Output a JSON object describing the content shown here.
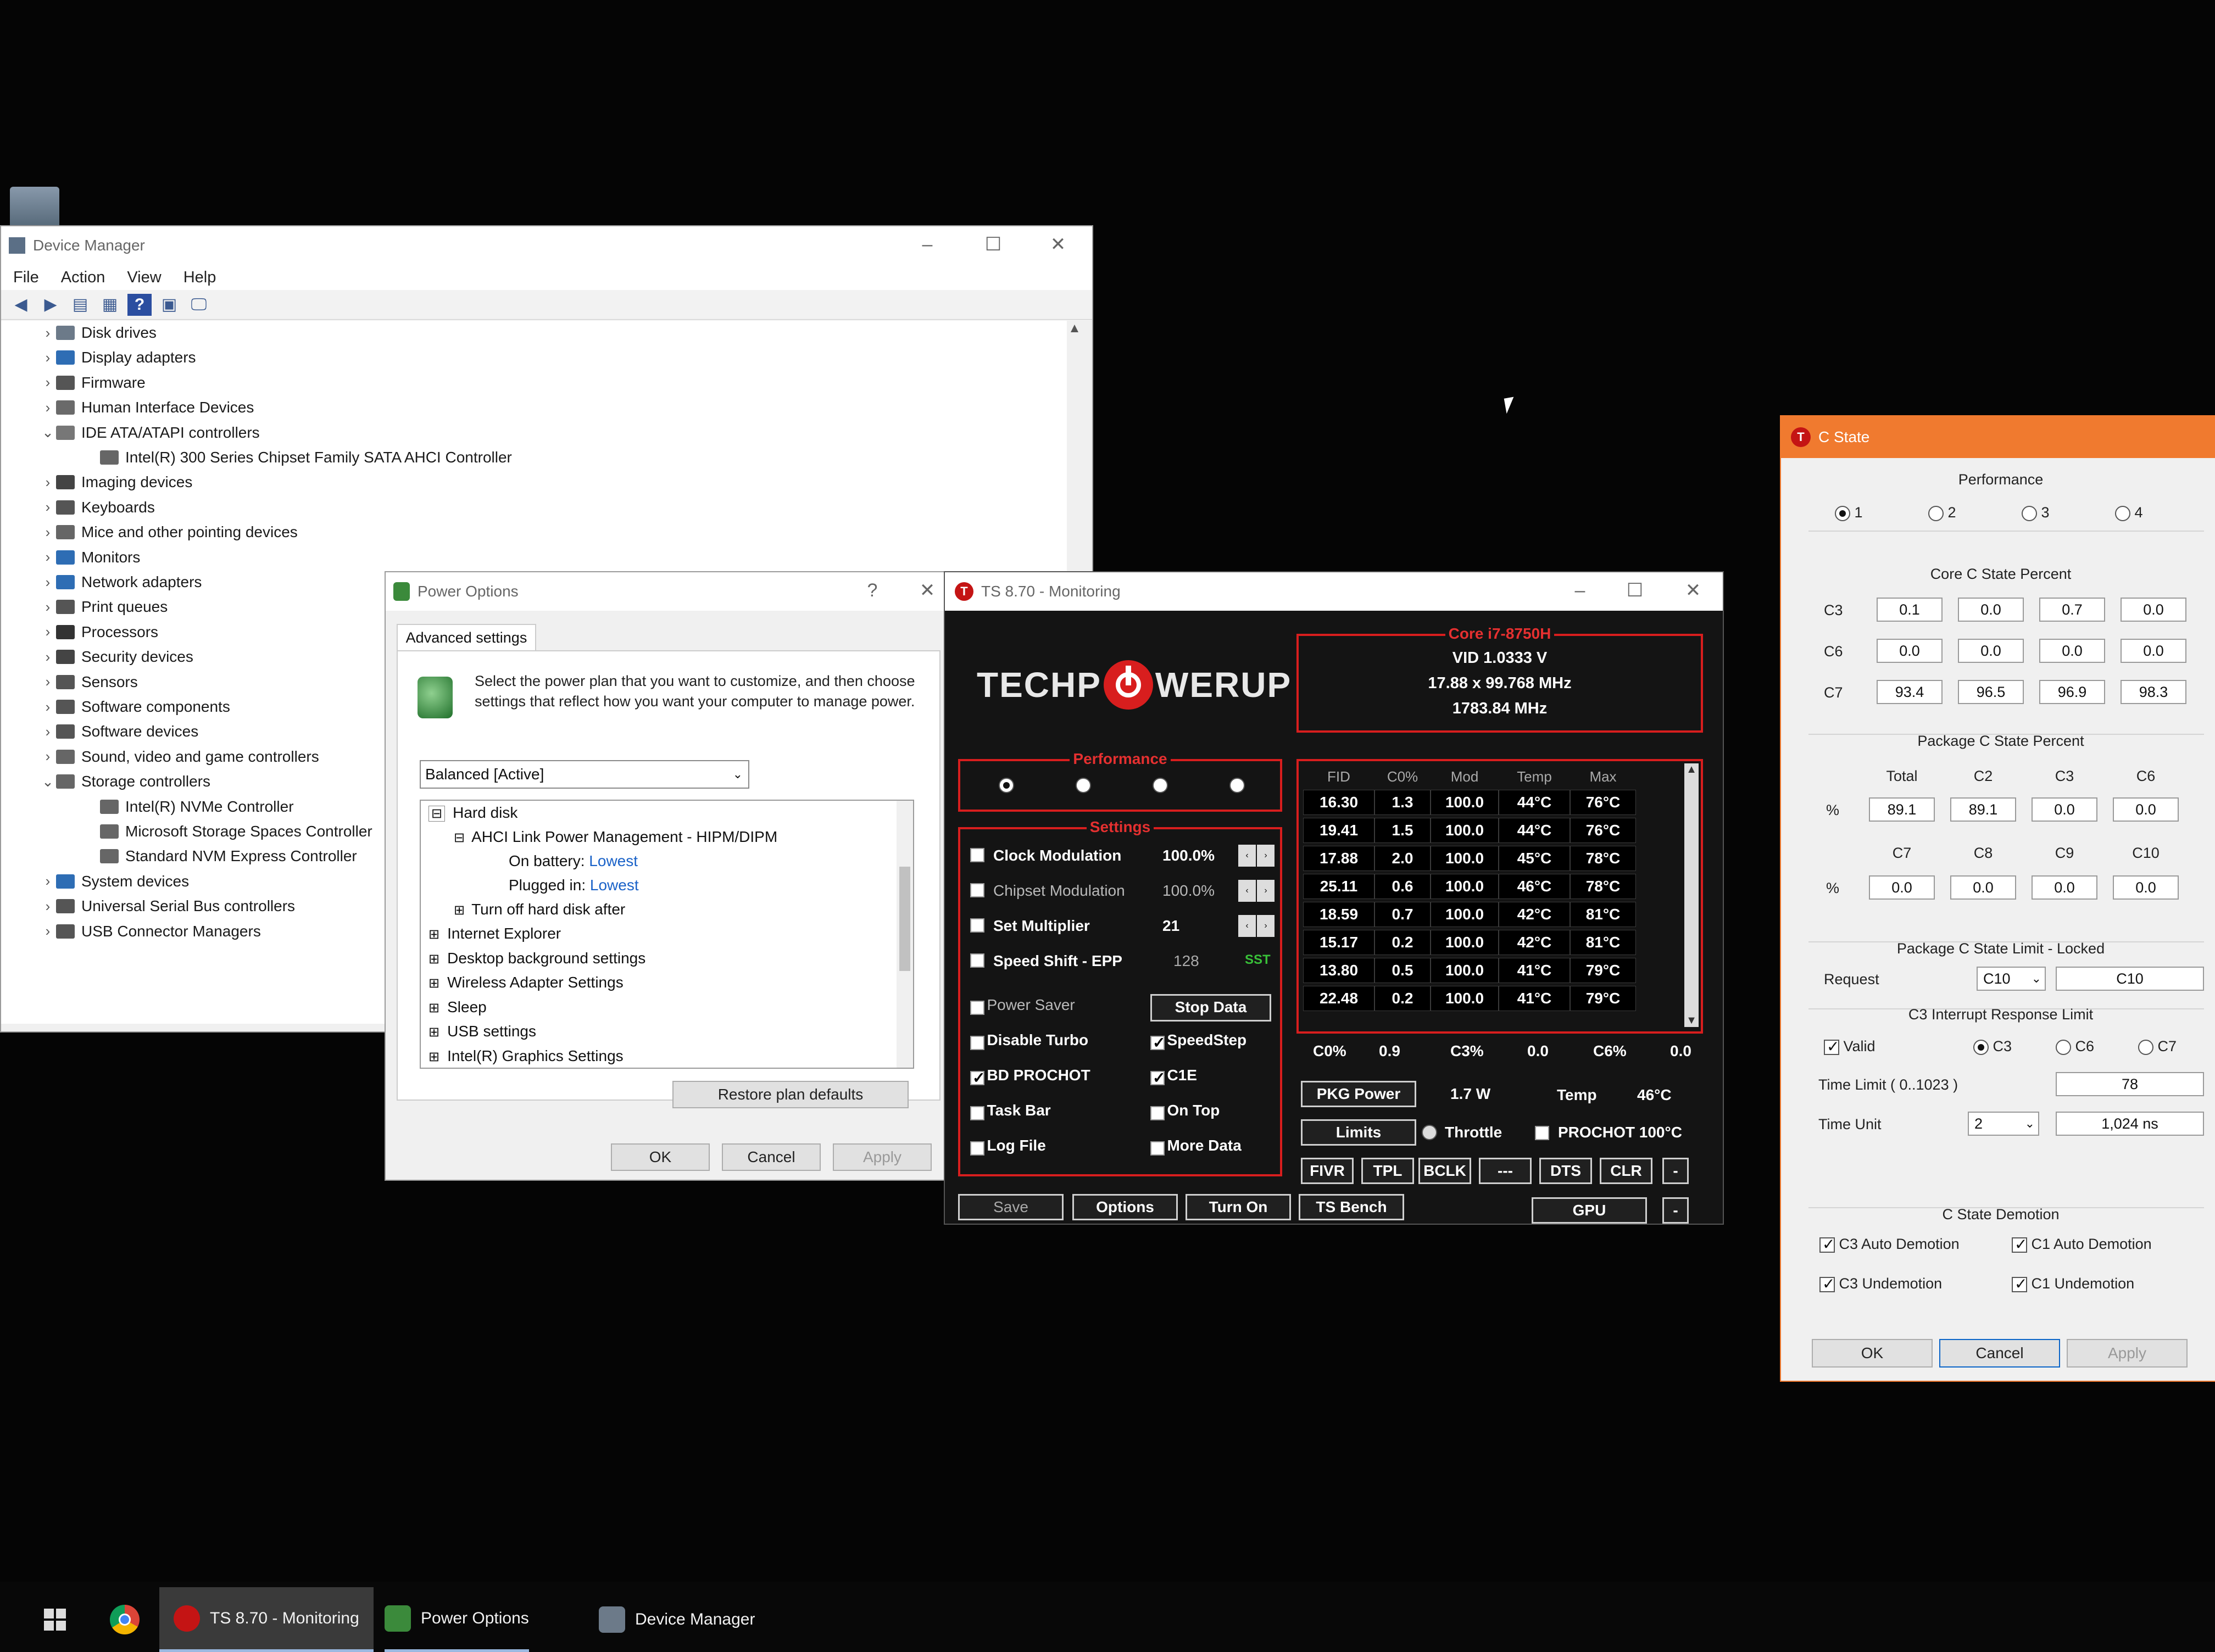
{
  "colors": {
    "accent_red": "#d81e1e",
    "cstate_title": "#f07a2f",
    "link_blue": "#1a62c8",
    "sst_green": "#39c039"
  },
  "device_manager": {
    "title": "Device Manager",
    "menu": [
      "File",
      "Action",
      "View",
      "Help"
    ],
    "tree": [
      {
        "label": "Disk drives",
        "expanded": false,
        "icon": "disk-icon"
      },
      {
        "label": "Display adapters",
        "expanded": false,
        "icon": "display-icon"
      },
      {
        "label": "Firmware",
        "expanded": false,
        "icon": "chip-icon"
      },
      {
        "label": "Human Interface Devices",
        "expanded": false,
        "icon": "hid-icon"
      },
      {
        "label": "IDE ATA/ATAPI controllers",
        "expanded": true,
        "icon": "ide-icon"
      },
      {
        "label": "Intel(R) 300 Series Chipset Family SATA AHCI Controller",
        "child": true,
        "icon": "controller-icon"
      },
      {
        "label": "Imaging devices",
        "expanded": false,
        "icon": "camera-icon"
      },
      {
        "label": "Keyboards",
        "expanded": false,
        "icon": "keyboard-icon"
      },
      {
        "label": "Mice and other pointing devices",
        "expanded": false,
        "icon": "mouse-icon"
      },
      {
        "label": "Monitors",
        "expanded": false,
        "icon": "monitor-icon"
      },
      {
        "label": "Network adapters",
        "expanded": false,
        "icon": "network-icon"
      },
      {
        "label": "Print queues",
        "expanded": false,
        "icon": "printer-icon"
      },
      {
        "label": "Processors",
        "expanded": false,
        "icon": "cpu-icon"
      },
      {
        "label": "Security devices",
        "expanded": false,
        "icon": "security-icon"
      },
      {
        "label": "Sensors",
        "expanded": false,
        "icon": "sensor-icon"
      },
      {
        "label": "Software components",
        "expanded": false,
        "icon": "component-icon"
      },
      {
        "label": "Software devices",
        "expanded": false,
        "icon": "software-icon"
      },
      {
        "label": "Sound, video and game controllers",
        "expanded": false,
        "icon": "sound-icon"
      },
      {
        "label": "Storage controllers",
        "expanded": true,
        "icon": "storage-icon"
      },
      {
        "label": "Intel(R) NVMe Controller",
        "child": true,
        "icon": "controller-icon"
      },
      {
        "label": "Microsoft Storage Spaces Controller",
        "child": true,
        "icon": "controller-icon"
      },
      {
        "label": "Standard NVM Express Controller",
        "child": true,
        "icon": "controller-icon"
      },
      {
        "label": "System devices",
        "expanded": false,
        "icon": "system-icon"
      },
      {
        "label": "Universal Serial Bus controllers",
        "expanded": false,
        "icon": "usb-icon"
      },
      {
        "label": "USB Connector Managers",
        "expanded": false,
        "icon": "usb-icon"
      }
    ]
  },
  "power_options": {
    "title": "Power Options",
    "help": "?",
    "tab": "Advanced settings",
    "description": "Select the power plan that you want to customize, and then choose settings that reflect how you want your computer to manage power.",
    "plan": "Balanced [Active]",
    "settings": {
      "hard_disk": "Hard disk",
      "ahci": "AHCI Link Power Management - HIPM/DIPM",
      "on_battery_label": "On battery:",
      "on_battery_value": "Lowest",
      "plugged_label": "Plugged in:",
      "plugged_value": "Lowest",
      "turn_off": "Turn off hard disk after",
      "others": [
        "Internet Explorer",
        "Desktop background settings",
        "Wireless Adapter Settings",
        "Sleep",
        "USB settings",
        "Intel(R) Graphics Settings"
      ]
    },
    "restore": "Restore plan defaults",
    "ok": "OK",
    "cancel": "Cancel",
    "apply": "Apply"
  },
  "throttlestop": {
    "title": "TS 8.70 - Monitoring",
    "logo_left": "TECHP",
    "logo_right": "WERUP",
    "cpu": {
      "title": "Core i7-8750H",
      "vid": "VID  1.0333 V",
      "multi": "17.88 x 99.768 MHz",
      "freq": "1783.84 MHz"
    },
    "performance_title": "Performance",
    "settings_title": "Settings",
    "options": [
      {
        "label": "Clock Modulation",
        "value": "100.0%",
        "checked": false,
        "dim": false
      },
      {
        "label": "Chipset Modulation",
        "value": "100.0%",
        "checked": false,
        "dim": true
      },
      {
        "label": "Set Multiplier",
        "value": "21",
        "checked": false,
        "dim": false
      },
      {
        "label": "Speed Shift - EPP",
        "value": "128",
        "extra": "SST",
        "checked": false,
        "dim": false
      }
    ],
    "left_checks": [
      {
        "label": "Power Saver",
        "checked": false,
        "dim": true
      },
      {
        "label": "Disable Turbo",
        "checked": false
      },
      {
        "label": "BD PROCHOT",
        "checked": true
      },
      {
        "label": "Task Bar",
        "checked": false
      },
      {
        "label": "Log File",
        "checked": false
      }
    ],
    "right_checks": [
      {
        "label": "SpeedStep",
        "checked": true
      },
      {
        "label": "C1E",
        "checked": true
      },
      {
        "label": "On Top",
        "checked": false
      },
      {
        "label": "More Data",
        "checked": false
      }
    ],
    "stop_data": "Stop Data",
    "grid": {
      "headers": [
        "FID",
        "C0%",
        "Mod",
        "Temp",
        "Max"
      ],
      "rows": [
        [
          "16.30",
          "1.3",
          "100.0",
          "44°C",
          "76°C"
        ],
        [
          "19.41",
          "1.5",
          "100.0",
          "44°C",
          "76°C"
        ],
        [
          "17.88",
          "2.0",
          "100.0",
          "45°C",
          "78°C"
        ],
        [
          "25.11",
          "0.6",
          "100.0",
          "46°C",
          "78°C"
        ],
        [
          "18.59",
          "0.7",
          "100.0",
          "42°C",
          "81°C"
        ],
        [
          "15.17",
          "0.2",
          "100.0",
          "42°C",
          "81°C"
        ],
        [
          "13.80",
          "0.5",
          "100.0",
          "41°C",
          "79°C"
        ],
        [
          "22.48",
          "0.2",
          "100.0",
          "41°C",
          "79°C"
        ]
      ]
    },
    "cstates": {
      "c0_label": "C0%",
      "c0": "0.9",
      "c3_label": "C3%",
      "c3": "0.0",
      "c6_label": "C6%",
      "c6": "0.0"
    },
    "pkg_power": "PKG Power",
    "power_value": "1.7 W",
    "temp_label": "Temp",
    "temp_value": "46°C",
    "limits": "Limits",
    "throttle": "Throttle",
    "prochot": "PROCHOT 100°C",
    "row_buttons": [
      "FIVR",
      "TPL",
      "BCLK",
      "---",
      "DTS",
      "CLR"
    ],
    "minus": "-",
    "bottom_buttons": [
      "Save",
      "Options",
      "Turn On",
      "TS Bench"
    ],
    "gpu": "GPU"
  },
  "cstate": {
    "title": "C State",
    "performance": "Performance",
    "perf_options": [
      "1",
      "2",
      "3",
      "4"
    ],
    "core_title": "Core C State Percent",
    "core_rows": [
      {
        "label": "C3",
        "values": [
          "0.1",
          "0.0",
          "0.7",
          "0.0"
        ]
      },
      {
        "label": "C6",
        "values": [
          "0.0",
          "0.0",
          "0.0",
          "0.0"
        ]
      },
      {
        "label": "C7",
        "values": [
          "93.4",
          "96.5",
          "96.9",
          "98.3"
        ]
      }
    ],
    "pkg_title": "Package C State Percent",
    "pkg_head1": [
      "Total",
      "C2",
      "C3",
      "C6"
    ],
    "pkg_row1": [
      "89.1",
      "89.1",
      "0.0",
      "0.0"
    ],
    "pkg_head2": [
      "C7",
      "C8",
      "C9",
      "C10"
    ],
    "pkg_row2": [
      "0.0",
      "0.0",
      "0.0",
      "0.0"
    ],
    "pct": "%",
    "limit_title": "Package C State Limit - Locked",
    "request": "Request",
    "request_sel": "C10",
    "request_val": "C10",
    "irl_title": "C3 Interrupt Response Limit",
    "valid": "Valid",
    "irl_options": [
      "C3",
      "C6",
      "C7"
    ],
    "time_limit": "Time Limit  ( 0..1023 )",
    "time_limit_val": "78",
    "time_unit": "Time Unit",
    "time_unit_sel": "2",
    "time_unit_val": "1,024 ns",
    "demotion_title": "C State Demotion",
    "demotion": [
      "C3 Auto Demotion",
      "C1 Auto Demotion",
      "C3 Undemotion",
      "C1 Undemotion"
    ],
    "ok": "OK",
    "cancel": "Cancel",
    "apply": "Apply"
  },
  "taskbar": {
    "items": [
      "TS 8.70 - Monitoring",
      "Power Options",
      "Device Manager"
    ]
  }
}
